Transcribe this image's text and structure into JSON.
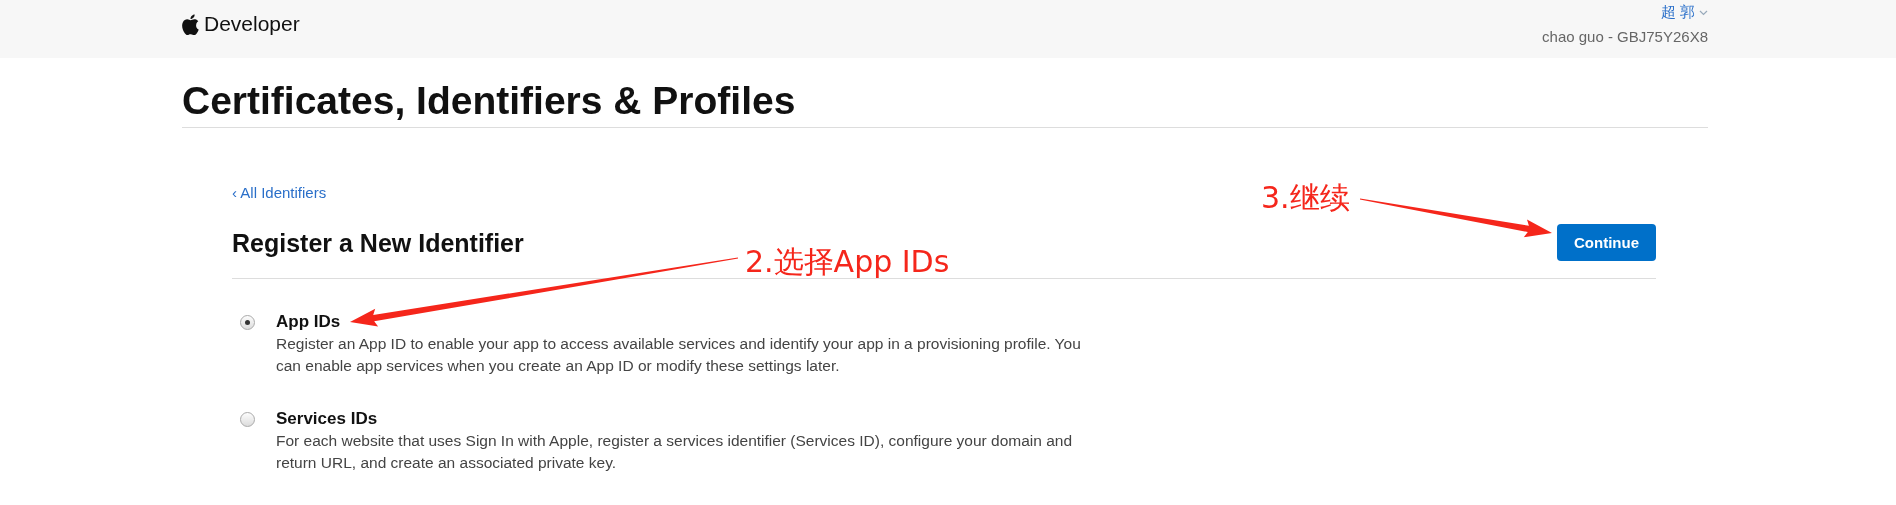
{
  "header": {
    "brand": "Developer",
    "user_name": "超 郭",
    "account": "chao guo - GBJ75Y26X8"
  },
  "page_title": "Certificates, Identifiers & Profiles",
  "back_link": "‹ All Identifiers",
  "heading": "Register a New Identifier",
  "continue_button": "Continue",
  "options": [
    {
      "title": "App IDs",
      "description": "Register an App ID to enable your app to access available services and identify your app in a provisioning profile. You can enable app services when you create an App ID or modify these settings later.",
      "selected": true
    },
    {
      "title": "Services IDs",
      "description": "For each website that uses Sign In with Apple, register a services identifier (Services ID), configure your domain and return URL, and create an associated private key.",
      "selected": false
    }
  ],
  "annotations": [
    {
      "text": "2.选择App IDs"
    },
    {
      "text": "3.继续"
    }
  ]
}
